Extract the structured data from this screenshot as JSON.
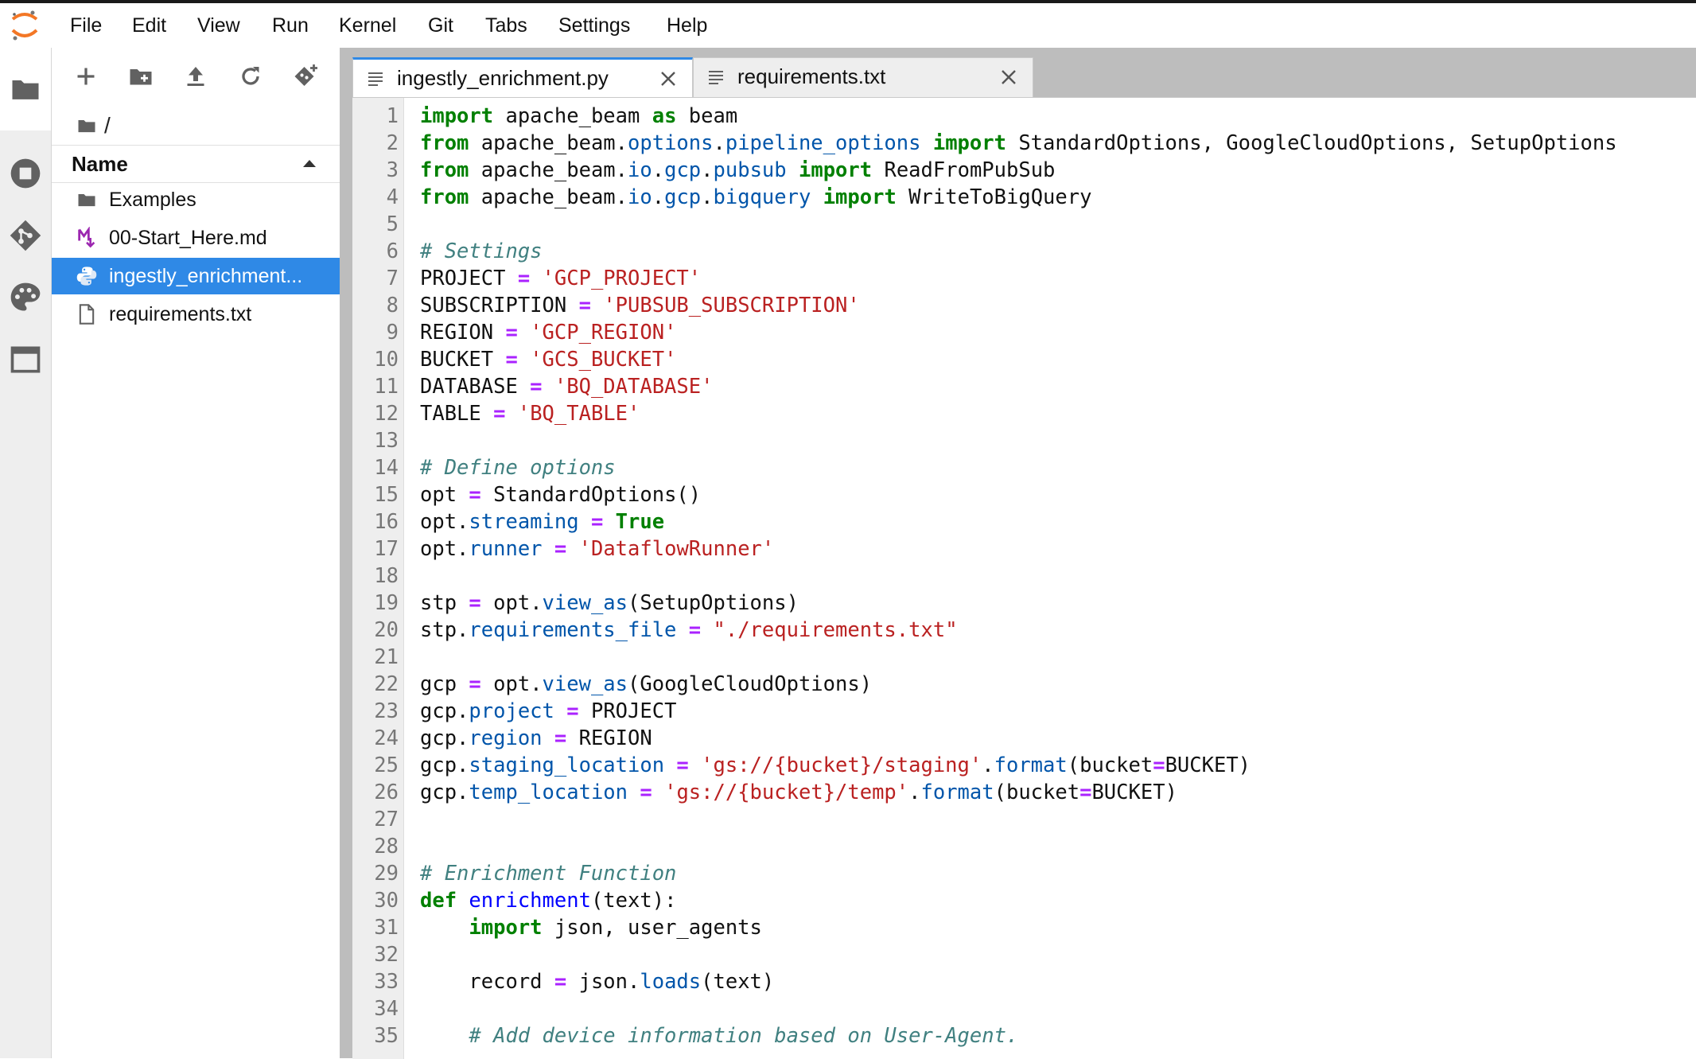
{
  "menu": [
    "File",
    "Edit",
    "View",
    "Run",
    "Kernel",
    "Git",
    "Tabs",
    "Settings",
    "Help"
  ],
  "sidebar_icons": [
    "folder-icon",
    "running-icon",
    "git-icon",
    "palette-icon",
    "tabs-icon"
  ],
  "toolbar_icons": [
    "new-launcher-icon",
    "new-folder-icon",
    "upload-icon",
    "refresh-icon",
    "git-clone-icon"
  ],
  "breadcrumb": {
    "path": "/"
  },
  "file_list": {
    "header": "Name",
    "items": [
      {
        "name": "Examples",
        "icon": "folder-icon",
        "selected": false
      },
      {
        "name": "00-Start_Here.md",
        "icon": "markdown-icon",
        "selected": false
      },
      {
        "name": "ingestly_enrichment...",
        "icon": "python-icon",
        "selected": true
      },
      {
        "name": "requirements.txt",
        "icon": "file-icon",
        "selected": false
      }
    ]
  },
  "tabs": [
    {
      "label": "ingestly_enrichment.py",
      "active": true
    },
    {
      "label": "requirements.txt",
      "active": false
    }
  ],
  "colors": {
    "accent": "#2f89e6",
    "keyword": "#008000",
    "operator": "#aa22ff",
    "string": "#ba2121",
    "comment": "#408080",
    "property": "#0055aa",
    "def_name": "#0000ff"
  },
  "code_lines": [
    {
      "n": "1",
      "tokens": [
        [
          "kw",
          "import"
        ],
        [
          "plain",
          " apache_beam "
        ],
        [
          "kw",
          "as"
        ],
        [
          "plain",
          " beam"
        ]
      ]
    },
    {
      "n": "2",
      "tokens": [
        [
          "kw",
          "from"
        ],
        [
          "plain",
          " apache_beam."
        ],
        [
          "prop",
          "options"
        ],
        [
          "plain",
          "."
        ],
        [
          "prop",
          "pipeline_options"
        ],
        [
          "plain",
          " "
        ],
        [
          "kw",
          "import"
        ],
        [
          "plain",
          " StandardOptions, GoogleCloudOptions, SetupOptions"
        ]
      ]
    },
    {
      "n": "3",
      "tokens": [
        [
          "kw",
          "from"
        ],
        [
          "plain",
          " apache_beam."
        ],
        [
          "prop",
          "io"
        ],
        [
          "plain",
          "."
        ],
        [
          "prop",
          "gcp"
        ],
        [
          "plain",
          "."
        ],
        [
          "prop",
          "pubsub"
        ],
        [
          "plain",
          " "
        ],
        [
          "kw",
          "import"
        ],
        [
          "plain",
          " ReadFromPubSub"
        ]
      ]
    },
    {
      "n": "4",
      "tokens": [
        [
          "kw",
          "from"
        ],
        [
          "plain",
          " apache_beam."
        ],
        [
          "prop",
          "io"
        ],
        [
          "plain",
          "."
        ],
        [
          "prop",
          "gcp"
        ],
        [
          "plain",
          "."
        ],
        [
          "prop",
          "bigquery"
        ],
        [
          "plain",
          " "
        ],
        [
          "kw",
          "import"
        ],
        [
          "plain",
          " WriteToBigQuery"
        ]
      ]
    },
    {
      "n": "5",
      "tokens": []
    },
    {
      "n": "6",
      "tokens": [
        [
          "com",
          "# Settings"
        ]
      ]
    },
    {
      "n": "7",
      "tokens": [
        [
          "plain",
          "PROJECT "
        ],
        [
          "op",
          "="
        ],
        [
          "plain",
          " "
        ],
        [
          "str",
          "'GCP_PROJECT'"
        ]
      ]
    },
    {
      "n": "8",
      "tokens": [
        [
          "plain",
          "SUBSCRIPTION "
        ],
        [
          "op",
          "="
        ],
        [
          "plain",
          " "
        ],
        [
          "str",
          "'PUBSUB_SUBSCRIPTION'"
        ]
      ]
    },
    {
      "n": "9",
      "tokens": [
        [
          "plain",
          "REGION "
        ],
        [
          "op",
          "="
        ],
        [
          "plain",
          " "
        ],
        [
          "str",
          "'GCP_REGION'"
        ]
      ]
    },
    {
      "n": "10",
      "tokens": [
        [
          "plain",
          "BUCKET "
        ],
        [
          "op",
          "="
        ],
        [
          "plain",
          " "
        ],
        [
          "str",
          "'GCS_BUCKET'"
        ]
      ]
    },
    {
      "n": "11",
      "tokens": [
        [
          "plain",
          "DATABASE "
        ],
        [
          "op",
          "="
        ],
        [
          "plain",
          " "
        ],
        [
          "str",
          "'BQ_DATABASE'"
        ]
      ]
    },
    {
      "n": "12",
      "tokens": [
        [
          "plain",
          "TABLE "
        ],
        [
          "op",
          "="
        ],
        [
          "plain",
          " "
        ],
        [
          "str",
          "'BQ_TABLE'"
        ]
      ]
    },
    {
      "n": "13",
      "tokens": []
    },
    {
      "n": "14",
      "tokens": [
        [
          "com",
          "# Define options"
        ]
      ]
    },
    {
      "n": "15",
      "tokens": [
        [
          "plain",
          "opt "
        ],
        [
          "op",
          "="
        ],
        [
          "plain",
          " StandardOptions()"
        ]
      ]
    },
    {
      "n": "16",
      "tokens": [
        [
          "plain",
          "opt."
        ],
        [
          "prop",
          "streaming"
        ],
        [
          "plain",
          " "
        ],
        [
          "op",
          "="
        ],
        [
          "plain",
          " "
        ],
        [
          "kw",
          "True"
        ]
      ]
    },
    {
      "n": "17",
      "tokens": [
        [
          "plain",
          "opt."
        ],
        [
          "prop",
          "runner"
        ],
        [
          "plain",
          " "
        ],
        [
          "op",
          "="
        ],
        [
          "plain",
          " "
        ],
        [
          "str",
          "'DataflowRunner'"
        ]
      ]
    },
    {
      "n": "18",
      "tokens": []
    },
    {
      "n": "19",
      "tokens": [
        [
          "plain",
          "stp "
        ],
        [
          "op",
          "="
        ],
        [
          "plain",
          " opt."
        ],
        [
          "prop",
          "view_as"
        ],
        [
          "plain",
          "(SetupOptions)"
        ]
      ]
    },
    {
      "n": "20",
      "tokens": [
        [
          "plain",
          "stp."
        ],
        [
          "prop",
          "requirements_file"
        ],
        [
          "plain",
          " "
        ],
        [
          "op",
          "="
        ],
        [
          "plain",
          " "
        ],
        [
          "str",
          "\"./requirements.txt\""
        ]
      ]
    },
    {
      "n": "21",
      "tokens": []
    },
    {
      "n": "22",
      "tokens": [
        [
          "plain",
          "gcp "
        ],
        [
          "op",
          "="
        ],
        [
          "plain",
          " opt."
        ],
        [
          "prop",
          "view_as"
        ],
        [
          "plain",
          "(GoogleCloudOptions)"
        ]
      ]
    },
    {
      "n": "23",
      "tokens": [
        [
          "plain",
          "gcp."
        ],
        [
          "prop",
          "project"
        ],
        [
          "plain",
          " "
        ],
        [
          "op",
          "="
        ],
        [
          "plain",
          " PROJECT"
        ]
      ]
    },
    {
      "n": "24",
      "tokens": [
        [
          "plain",
          "gcp."
        ],
        [
          "prop",
          "region"
        ],
        [
          "plain",
          " "
        ],
        [
          "op",
          "="
        ],
        [
          "plain",
          " REGION"
        ]
      ]
    },
    {
      "n": "25",
      "tokens": [
        [
          "plain",
          "gcp."
        ],
        [
          "prop",
          "staging_location"
        ],
        [
          "plain",
          " "
        ],
        [
          "op",
          "="
        ],
        [
          "plain",
          " "
        ],
        [
          "str",
          "'gs://{bucket}/staging'"
        ],
        [
          "plain",
          "."
        ],
        [
          "prop",
          "format"
        ],
        [
          "plain",
          "(bucket"
        ],
        [
          "op",
          "="
        ],
        [
          "plain",
          "BUCKET)"
        ]
      ]
    },
    {
      "n": "26",
      "tokens": [
        [
          "plain",
          "gcp."
        ],
        [
          "prop",
          "temp_location"
        ],
        [
          "plain",
          " "
        ],
        [
          "op",
          "="
        ],
        [
          "plain",
          " "
        ],
        [
          "str",
          "'gs://{bucket}/temp'"
        ],
        [
          "plain",
          "."
        ],
        [
          "prop",
          "format"
        ],
        [
          "plain",
          "(bucket"
        ],
        [
          "op",
          "="
        ],
        [
          "plain",
          "BUCKET)"
        ]
      ]
    },
    {
      "n": "27",
      "tokens": []
    },
    {
      "n": "28",
      "tokens": []
    },
    {
      "n": "29",
      "tokens": [
        [
          "com",
          "# Enrichment Function"
        ]
      ]
    },
    {
      "n": "30",
      "tokens": [
        [
          "kw",
          "def"
        ],
        [
          "plain",
          " "
        ],
        [
          "def",
          "enrichment"
        ],
        [
          "plain",
          "(text):"
        ]
      ]
    },
    {
      "n": "31",
      "tokens": [
        [
          "plain",
          "    "
        ],
        [
          "kw",
          "import"
        ],
        [
          "plain",
          " json, user_agents"
        ]
      ]
    },
    {
      "n": "32",
      "tokens": []
    },
    {
      "n": "33",
      "tokens": [
        [
          "plain",
          "    record "
        ],
        [
          "op",
          "="
        ],
        [
          "plain",
          " json."
        ],
        [
          "prop",
          "loads"
        ],
        [
          "plain",
          "(text)"
        ]
      ]
    },
    {
      "n": "34",
      "tokens": []
    },
    {
      "n": "35",
      "tokens": [
        [
          "plain",
          "    "
        ],
        [
          "com",
          "# Add device information based on User-Agent."
        ]
      ]
    }
  ]
}
